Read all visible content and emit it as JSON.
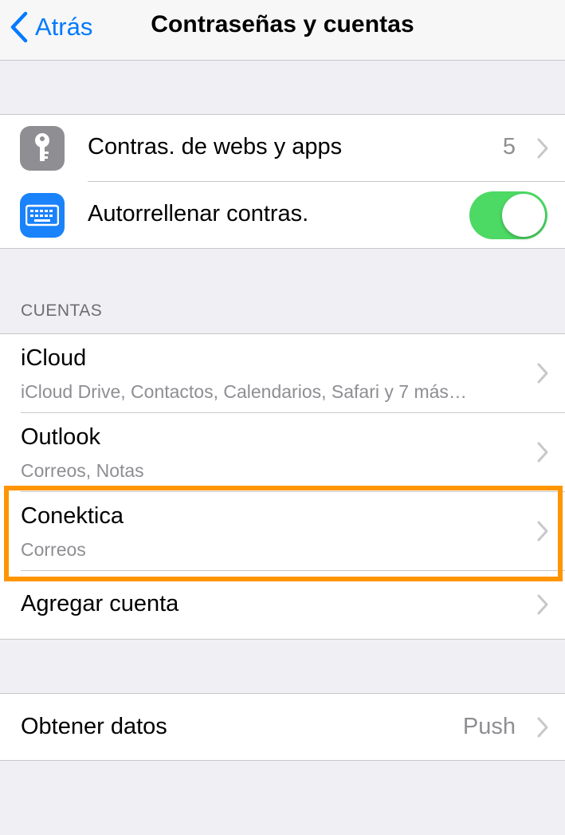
{
  "navbar": {
    "back_label": "Atrás",
    "title": "Contraseñas y cuentas"
  },
  "passwords": {
    "web_apps_label": "Contras. de webs y apps",
    "web_apps_count": "5",
    "autofill_label": "Autorrellenar contras.",
    "autofill_enabled": true
  },
  "accounts": {
    "header": "CUENTAS",
    "items": [
      {
        "name": "iCloud",
        "detail": "iCloud Drive, Contactos, Calendarios, Safari y 7 más…"
      },
      {
        "name": "Outlook",
        "detail": "Correos, Notas"
      },
      {
        "name": "Conektica",
        "detail": "Correos"
      }
    ],
    "add_label": "Agregar cuenta"
  },
  "fetch": {
    "label": "Obtener datos",
    "value": "Push"
  },
  "colors": {
    "accent": "#007aff",
    "toggle_on": "#4cd964",
    "highlight": "#ff9500",
    "keyboard_icon_bg": "#1a82fb",
    "key_icon_bg": "#8e8e93"
  }
}
